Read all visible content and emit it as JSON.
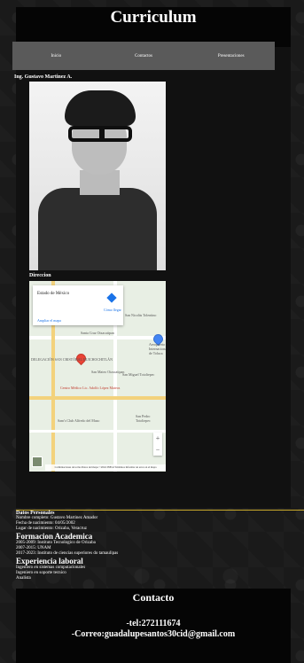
{
  "site": {
    "title": "Curriculum"
  },
  "nav": {
    "items": [
      "Inicio",
      "Contactos",
      "Presentaciones"
    ]
  },
  "profile": {
    "name_label": "Ing. Gustavo Martinez A."
  },
  "location": {
    "label": "Direccion",
    "map": {
      "place_name": "Estado de México",
      "directions_label": "Cómo llegar",
      "zoom_link": "Ampliar el mapa",
      "footer_text": "Combinaciones de teclas Datos del mapa ©2024 INEGI Términos Informar un error en el mapa",
      "labels": [
        "San Nicolás Tolentino",
        "Santa Cruz Otzacatipan",
        "San Mateo Otzacatipan",
        "Aeropuerto Internacional de Toluca",
        "San Miguel Totoltepec",
        "Centro Médico Lic. Adolfo López Mateos",
        "DELEGACIÓN SAN CRISTÓBAL HUICHOCHITLÁN",
        "San Pedro Totoltepec",
        "Sam's Club Alfredo del Mazo"
      ]
    }
  },
  "personal": {
    "title": "Datos Personales",
    "lines": [
      "Nombre completo: Gustavo Martinez Amador",
      "Fecha de nacimiento: 04/05/2002",
      "Lugar de nacimiento: Orizaba, Veracruz"
    ],
    "education_heading": "Formacion Academica",
    "education_lines": [
      "2005-2009: Instituto Tecnologico de Orizaba",
      "2007-2015: UNAM",
      "2017-2023: Instituto de ciencias superiores do tamaulipas"
    ],
    "experience_heading": "Experiencia laboral",
    "experience_lines": [
      "Ingeniero en sistemas computacionales",
      "Ingeniero en soporte tecnico",
      "Analista"
    ]
  },
  "contact": {
    "title": "Contacto",
    "phone": "-tel:272111674",
    "email": "-Correo:guadalupesantos30cid@gmail.com"
  }
}
